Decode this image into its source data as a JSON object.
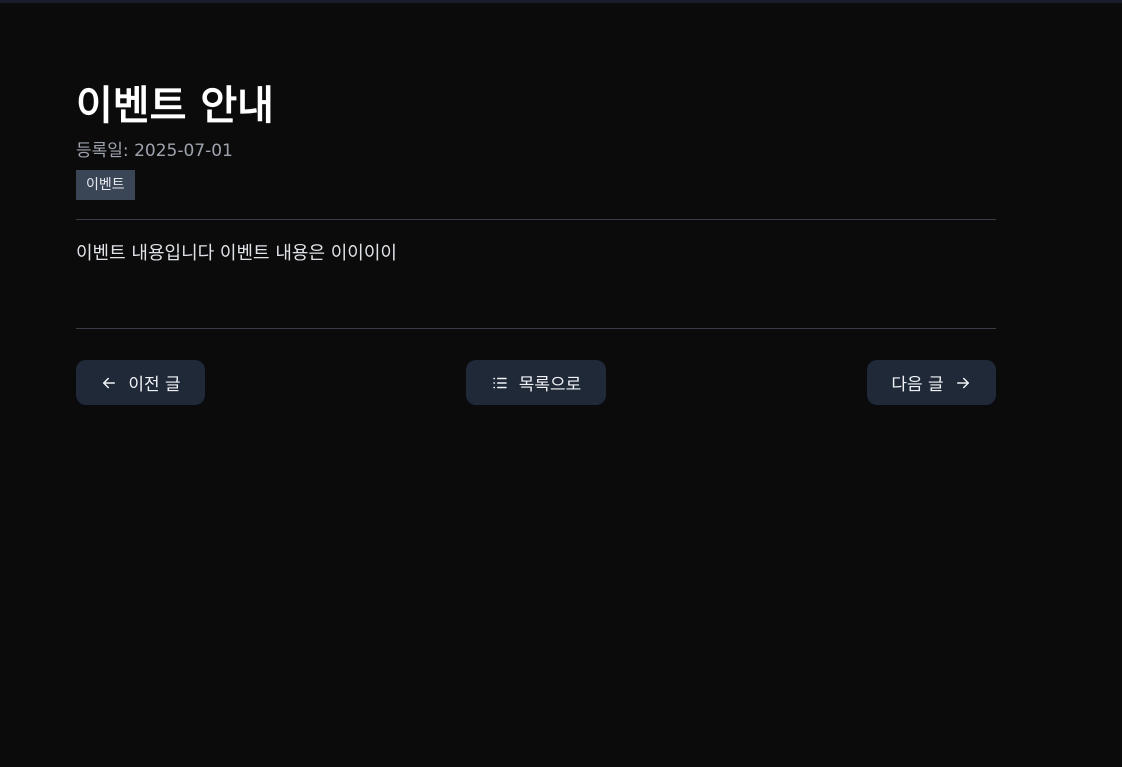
{
  "post": {
    "title": "이벤트 안내",
    "meta_label": "등록일:",
    "date": "2025-07-01",
    "category": "이벤트",
    "body": "이벤트 내용입니다 이벤트 내용은 이이이이"
  },
  "nav": {
    "prev_label": "이전 글",
    "list_label": "목록으로",
    "next_label": "다음 글"
  },
  "colors": {
    "background": "#0b0b0c",
    "button_bg": "#1f2938",
    "badge_bg": "#3a4556",
    "divider": "#3b3c47"
  },
  "icons": {
    "prev": "arrow-left-icon",
    "list": "list-icon",
    "next": "arrow-right-icon"
  }
}
